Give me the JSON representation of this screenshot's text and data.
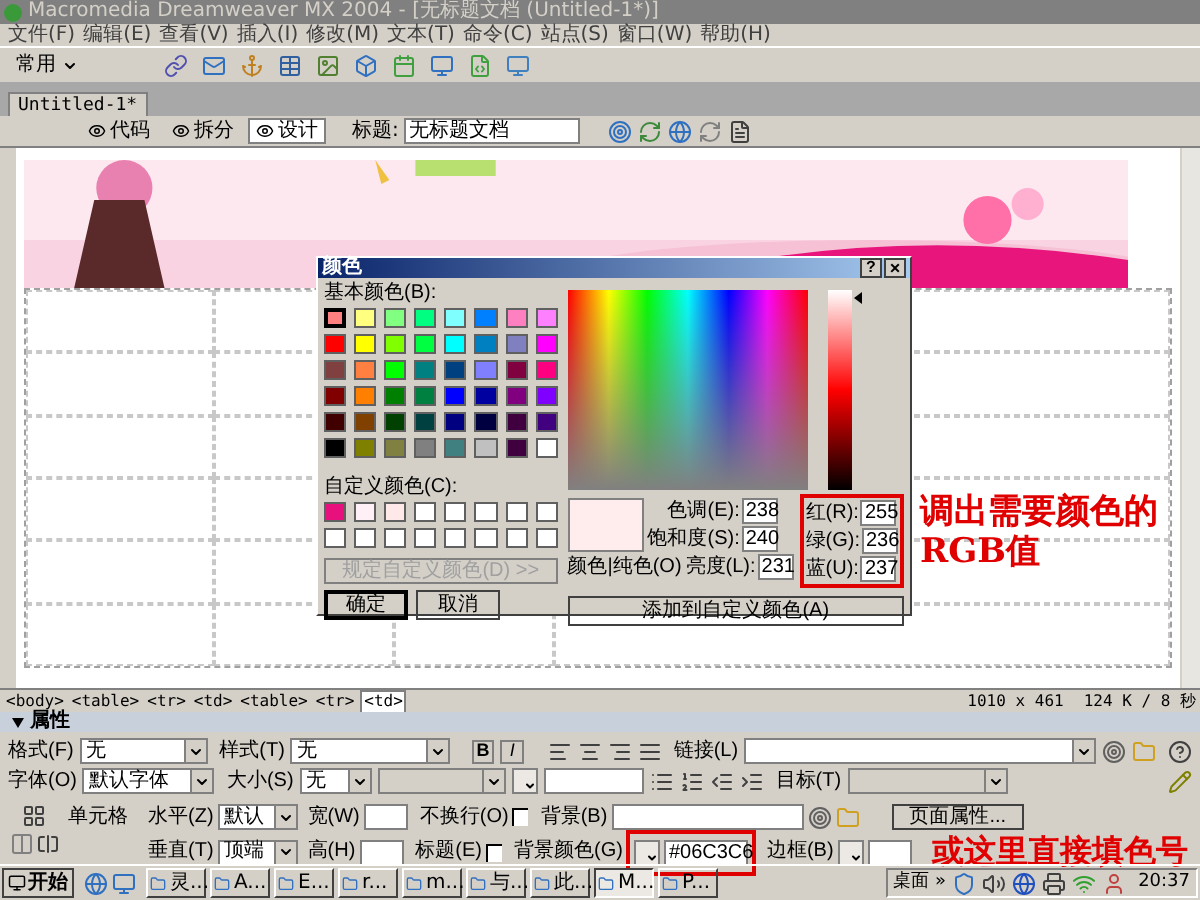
{
  "window": {
    "title": "Macromedia Dreamweaver MX 2004 - [无标题文档 (Untitled-1*)]"
  },
  "menu": [
    "文件(F)",
    "编辑(E)",
    "查看(V)",
    "插入(I)",
    "修改(M)",
    "文本(T)",
    "命令(C)",
    "站点(S)",
    "窗口(W)",
    "帮助(H)"
  ],
  "insert_bar": {
    "category": "常用"
  },
  "document_tab": {
    "label": "Untitled-1*"
  },
  "view_buttons": [
    {
      "label": "代码",
      "selected": false
    },
    {
      "label": "拆分",
      "selected": false
    },
    {
      "label": "设计",
      "selected": true
    }
  ],
  "title_field": {
    "label": "标题:",
    "value": "无标题文档"
  },
  "color_dialog": {
    "title": "颜色",
    "help_button": "?",
    "close_button": "×",
    "basic_label": "基本颜色(B):",
    "basic_colors": [
      {
        "color": "#ff8080",
        "selected": true
      },
      {
        "color": "#ffff80",
        "selected": false
      },
      {
        "color": "#80ff80",
        "selected": false
      },
      {
        "color": "#00ff80",
        "selected": false
      },
      {
        "color": "#80ffff",
        "selected": false
      },
      {
        "color": "#0080ff",
        "selected": false
      },
      {
        "color": "#ff80c0",
        "selected": false
      },
      {
        "color": "#ff80ff",
        "selected": false
      },
      {
        "color": "#ff0000",
        "selected": false
      },
      {
        "color": "#ffff00",
        "selected": false
      },
      {
        "color": "#80ff00",
        "selected": false
      },
      {
        "color": "#00ff40",
        "selected": false
      },
      {
        "color": "#00ffff",
        "selected": false
      },
      {
        "color": "#0080c0",
        "selected": false
      },
      {
        "color": "#8080c0",
        "selected": false
      },
      {
        "color": "#ff00ff",
        "selected": false
      },
      {
        "color": "#804040",
        "selected": false
      },
      {
        "color": "#ff8040",
        "selected": false
      },
      {
        "color": "#00ff00",
        "selected": false
      },
      {
        "color": "#008080",
        "selected": false
      },
      {
        "color": "#004080",
        "selected": false
      },
      {
        "color": "#8080ff",
        "selected": false
      },
      {
        "color": "#800040",
        "selected": false
      },
      {
        "color": "#ff0080",
        "selected": false
      },
      {
        "color": "#800000",
        "selected": false
      },
      {
        "color": "#ff8000",
        "selected": false
      },
      {
        "color": "#008000",
        "selected": false
      },
      {
        "color": "#008040",
        "selected": false
      },
      {
        "color": "#0000ff",
        "selected": false
      },
      {
        "color": "#0000a0",
        "selected": false
      },
      {
        "color": "#800080",
        "selected": false
      },
      {
        "color": "#8000ff",
        "selected": false
      },
      {
        "color": "#400000",
        "selected": false
      },
      {
        "color": "#804000",
        "selected": false
      },
      {
        "color": "#004000",
        "selected": false
      },
      {
        "color": "#004040",
        "selected": false
      },
      {
        "color": "#000080",
        "selected": false
      },
      {
        "color": "#000040",
        "selected": false
      },
      {
        "color": "#400040",
        "selected": false
      },
      {
        "color": "#400080",
        "selected": false
      },
      {
        "color": "#000000",
        "selected": false
      },
      {
        "color": "#808000",
        "selected": false
      },
      {
        "color": "#808040",
        "selected": false
      },
      {
        "color": "#808080",
        "selected": false
      },
      {
        "color": "#408080",
        "selected": false
      },
      {
        "color": "#c0c0c0",
        "selected": false
      },
      {
        "color": "#400040",
        "selected": false
      },
      {
        "color": "#ffffff",
        "selected": false
      }
    ],
    "custom_label": "自定义颜色(C):",
    "custom_colors": [
      {
        "color": "#e8107c"
      },
      {
        "color": "#fff0f8"
      },
      {
        "color": "#ffe8e8"
      },
      {
        "color": "#ffffff"
      },
      {
        "color": "#ffffff"
      },
      {
        "color": "#ffffff"
      },
      {
        "color": "#ffffff"
      },
      {
        "color": "#ffffff"
      },
      {
        "color": "#ffffff"
      },
      {
        "color": "#ffffff"
      },
      {
        "color": "#ffffff"
      },
      {
        "color": "#ffffff"
      },
      {
        "color": "#ffffff"
      },
      {
        "color": "#ffffff"
      },
      {
        "color": "#ffffff"
      },
      {
        "color": "#ffffff"
      }
    ],
    "define_button": {
      "label": "规定自定义颜色(D) >>",
      "disabled": true
    },
    "ok_button": "确定",
    "cancel_button": "取消",
    "luminance": {
      "level": 0.96
    },
    "preview": {
      "color": "#ffeced"
    },
    "solid_label": "颜色|纯色(O)",
    "hsl_fields": [
      {
        "label": "色调(E):",
        "value": "238"
      },
      {
        "label": "饱和度(S):",
        "value": "240"
      },
      {
        "label": "亮度(L):",
        "value": "231"
      }
    ],
    "rgb_fields": [
      {
        "label": "红(R):",
        "value": "255"
      },
      {
        "label": "绿(G):",
        "value": "236"
      },
      {
        "label": "蓝(U):",
        "value": "237"
      }
    ],
    "add_button": "添加到自定义颜色(A)"
  },
  "annotations": [
    "调出需要颜色的RGB值",
    "或这里直接填色号"
  ],
  "tag_selector": {
    "tags": [
      {
        "label": "<body>",
        "selected": false
      },
      {
        "label": "<table>",
        "selected": false
      },
      {
        "label": "<tr>",
        "selected": false
      },
      {
        "label": "<td>",
        "selected": false
      },
      {
        "label": "<table>",
        "selected": false
      },
      {
        "label": "<tr>",
        "selected": false
      },
      {
        "label": "<td>",
        "selected": true
      }
    ],
    "window_size": "1010 x 461",
    "download": "124 K / 8 秒"
  },
  "properties": {
    "title": "属性",
    "format": {
      "label": "格式(F)",
      "value": "无"
    },
    "style": {
      "label": "样式(T)",
      "value": "无"
    },
    "bold_button": "B",
    "italic_button": "I",
    "link": {
      "label": "链接(L)"
    },
    "font": {
      "label": "字体(O)",
      "value": "默认字体"
    },
    "size": {
      "label": "大小(S)",
      "value": "无"
    },
    "target": {
      "label": "目标(T)",
      "disabled": true
    },
    "cell_label": "单元格",
    "horizontal": {
      "label": "水平(Z)",
      "value": "默认"
    },
    "width": {
      "label": "宽(W)"
    },
    "no_wrap": {
      "label": "不换行(O)",
      "checked": false
    },
    "background": {
      "label": "背景(B)"
    },
    "page_properties_button": "页面属性...",
    "vertical": {
      "label": "垂直(T)",
      "value": "顶端"
    },
    "height": {
      "label": "高(H)"
    },
    "header": {
      "label": "标题(E)",
      "checked": false
    },
    "bg_color": {
      "label": "背景颜色(G)",
      "value": "#06C3C6"
    },
    "border": {
      "label": "边框(B)"
    }
  },
  "taskbar": {
    "start_button": "开始",
    "items": [
      {
        "label": "灵...",
        "selected": false
      },
      {
        "label": "A...",
        "selected": false
      },
      {
        "label": "E...",
        "selected": false
      },
      {
        "label": "r...",
        "selected": false
      },
      {
        "label": "m...",
        "selected": false
      },
      {
        "label": "与...",
        "selected": false
      },
      {
        "label": "此...",
        "selected": false
      },
      {
        "label": "M...",
        "selected": true
      },
      {
        "label": "P...",
        "selected": false
      }
    ],
    "desktop": "桌面 »",
    "clock": "20:37"
  }
}
